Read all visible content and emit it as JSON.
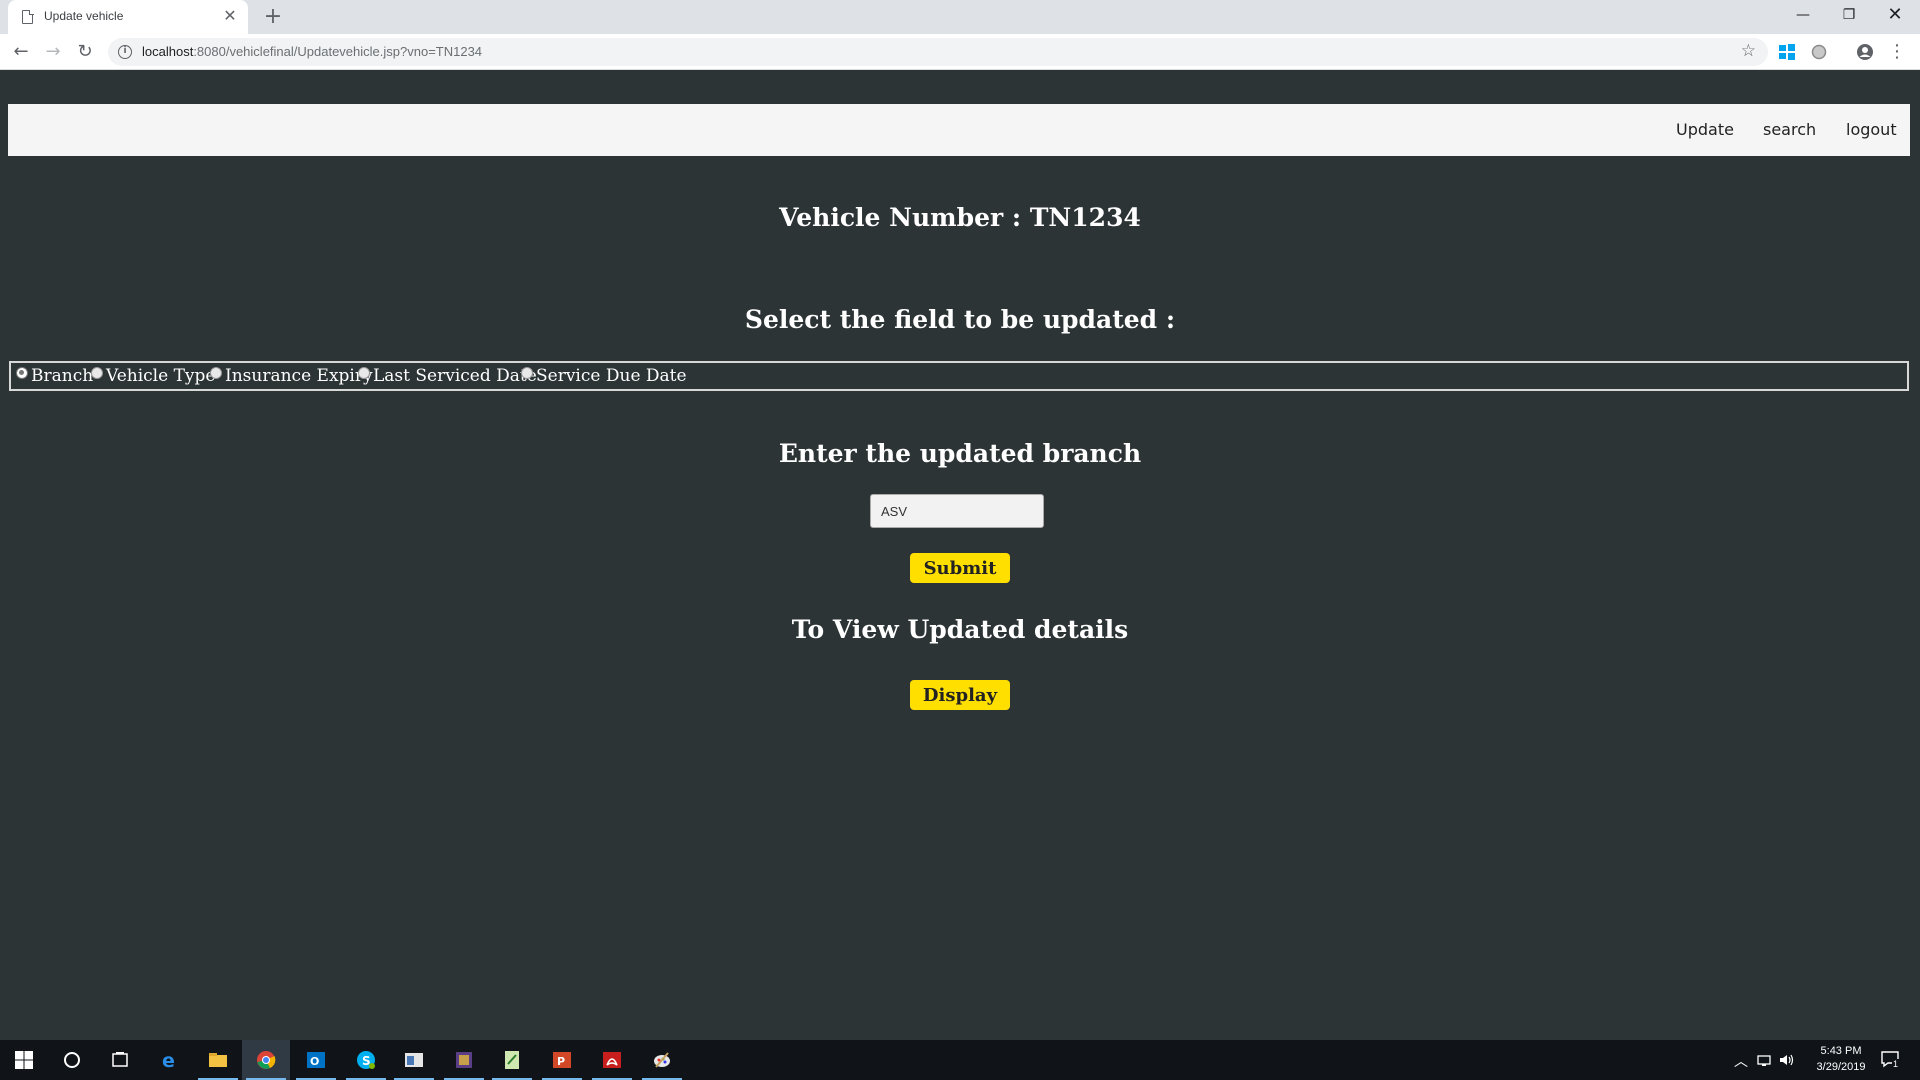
{
  "browser": {
    "tab_title": "Update vehicle",
    "new_tab": "+",
    "url_host": "localhost",
    "url_rest": ":8080/vehiclefinal/Updatevehicle.jsp?vno=TN1234"
  },
  "nav": {
    "links": [
      "Update",
      "search",
      "logout"
    ]
  },
  "main": {
    "vehicle_heading": "Vehicle Number : TN1234",
    "select_heading": "Select the field to be updated :",
    "options": [
      "Branch",
      "Vehicle Type",
      "Insurance Expiry",
      "Last Serviced Date",
      "Service Due Date"
    ],
    "selected_option": "Branch",
    "input_heading": "Enter the updated branch",
    "input_value": "ASV",
    "submit_label": "Submit",
    "view_heading": "To View Updated details",
    "display_label": "Display"
  },
  "taskbar": {
    "time": "5:43 PM",
    "date": "3/29/2019",
    "notifications": "1"
  },
  "colors": {
    "page_bg": "#2d3436",
    "button_yellow": "#ffdf00",
    "navbar_bg": "#f5f5f5"
  }
}
